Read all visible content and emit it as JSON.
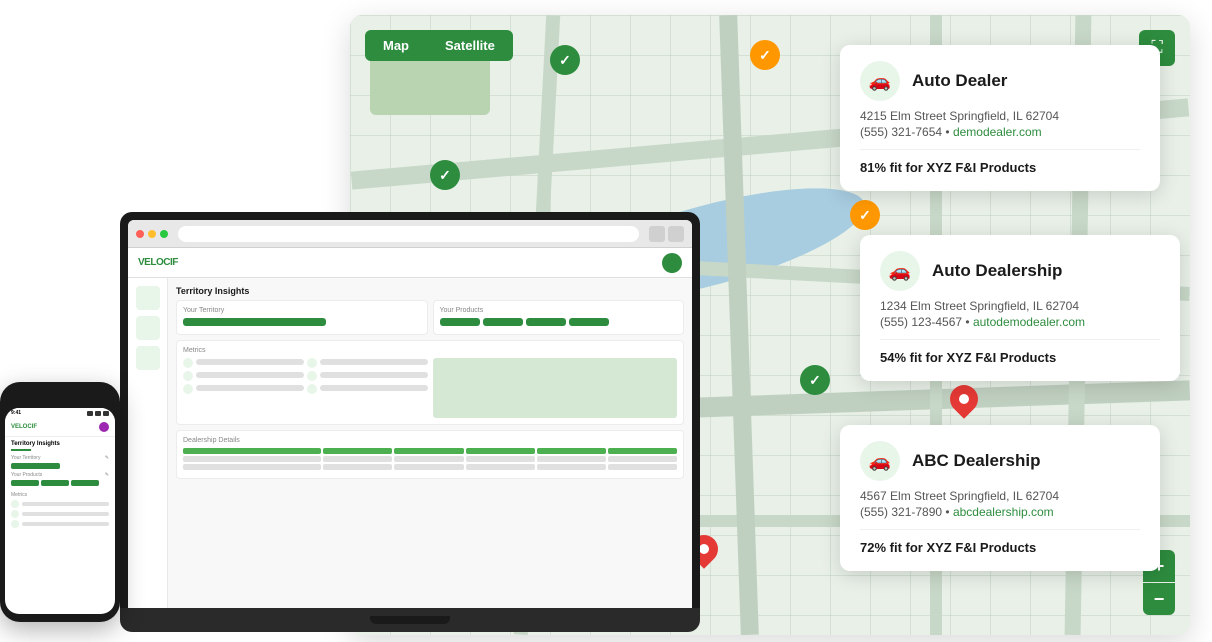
{
  "map": {
    "btn_map": "Map",
    "btn_satellite": "Satellite",
    "expand_icon": "⛶",
    "zoom_in": "+",
    "zoom_out": "−"
  },
  "dealers": [
    {
      "name": "Auto Dealer",
      "address": "4215 Elm Street Springfield, IL 62704",
      "phone": "(555) 321-7654",
      "website": "demodealer.com",
      "fit": "81% fit for XYZ F&I Products",
      "pin_color": "green"
    },
    {
      "name": "Auto Dealership",
      "address": "1234 Elm Street Springfield, IL 62704",
      "phone": "(555) 123-4567",
      "website": "autodemodealer.com",
      "fit": "54% fit for XYZ F&I Products",
      "pin_color": "red"
    },
    {
      "name": "ABC Dealership",
      "address": "4567 Elm Street Springfield, IL 62704",
      "phone": "(555) 321-7890",
      "website": "abcdealership.com",
      "fit": "72% fit for XYZ F&I Products",
      "pin_color": "green"
    }
  ],
  "laptop": {
    "app_name": "VELOCIF",
    "page_title": "Territory Insights",
    "your_territory": "Your Territory",
    "your_products": "Your Products",
    "metrics": "Metrics",
    "dealership_details": "Dealership Details"
  },
  "phone": {
    "time": "9:41",
    "app_name": "VELOCIF",
    "page_title": "Territory Insights",
    "your_territory": "Your Territory",
    "your_products": "Your Products",
    "metrics": "Metrics"
  }
}
